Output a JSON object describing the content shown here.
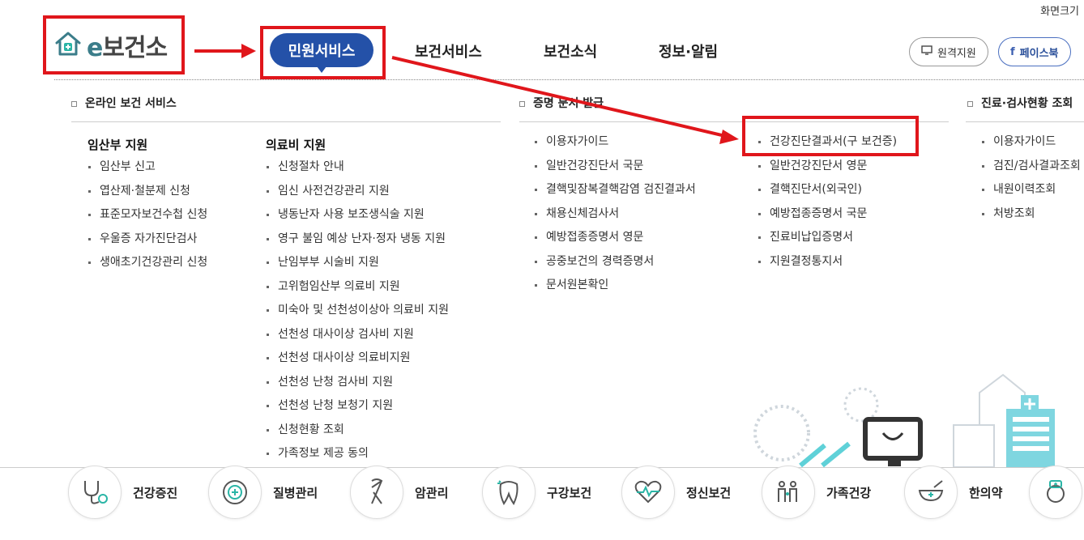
{
  "util": {
    "zoom": "화면크기"
  },
  "logo": {
    "e": "e",
    "name": "보건소"
  },
  "nav": [
    {
      "label": "민원서비스"
    },
    {
      "label": "보건서비스"
    },
    {
      "label": "보건소식"
    },
    {
      "label": "정보·알림"
    }
  ],
  "header_buttons": {
    "remote": "원격지원",
    "facebook": "페이스북"
  },
  "menu": {
    "online": {
      "title": "온라인 보건 서비스",
      "col1": {
        "head": "임산부 지원",
        "items": [
          "임산부 신고",
          "엽산제·철분제 신청",
          "표준모자보건수첩 신청",
          "우울증 자가진단검사",
          "생애초기건강관리 신청"
        ]
      },
      "col2": {
        "head": "의료비 지원",
        "items": [
          "신청절차 안내",
          "임신 사전건강관리 지원",
          "냉동난자 사용 보조생식술 지원",
          "영구 불임 예상 난자·정자 냉동 지원",
          "난임부부 시술비 지원",
          "고위험임산부 의료비 지원",
          "미숙아 및 선천성이상아 의료비 지원",
          "선천성 대사이상 검사비 지원",
          "선천성 대사이상 의료비지원",
          "선천성 난청 검사비 지원",
          "선천성 난청 보청기 지원",
          "신청현황 조회",
          "가족정보 제공 동의"
        ]
      }
    },
    "certificate": {
      "title": "증명 문서 발급",
      "col1": [
        "이용자가이드",
        "일반건강진단서 국문",
        "결핵및잠복결핵감염 검진결과서",
        "채용신체검사서",
        "예방접종증명서 영문",
        "공중보건의 경력증명서",
        "문서원본확인"
      ],
      "col2": [
        "건강진단결과서(구 보건증)",
        "일반건강진단서 영문",
        "결핵진단서(외국인)",
        "예방접종증명서 국문",
        "진료비납입증명서",
        "지원결정통지서"
      ]
    },
    "records": {
      "title": "진료·검사현황 조회",
      "items": [
        "이용자가이드",
        "검진/검사결과조회",
        "내원이력조회",
        "처방조회"
      ]
    }
  },
  "quick": [
    {
      "label": "건강증진",
      "icon": "stethoscope-icon"
    },
    {
      "label": "질병관리",
      "icon": "cross-circle-icon"
    },
    {
      "label": "암관리",
      "icon": "ribbon-icon"
    },
    {
      "label": "구강보건",
      "icon": "tooth-icon"
    },
    {
      "label": "정신보건",
      "icon": "heart-pulse-icon"
    },
    {
      "label": "가족건강",
      "icon": "family-icon"
    },
    {
      "label": "한의약",
      "icon": "mortar-icon"
    }
  ],
  "colors": {
    "accent": "#2451a8",
    "annotation": "#e0161b",
    "brand_teal": "#3b7d8a"
  }
}
